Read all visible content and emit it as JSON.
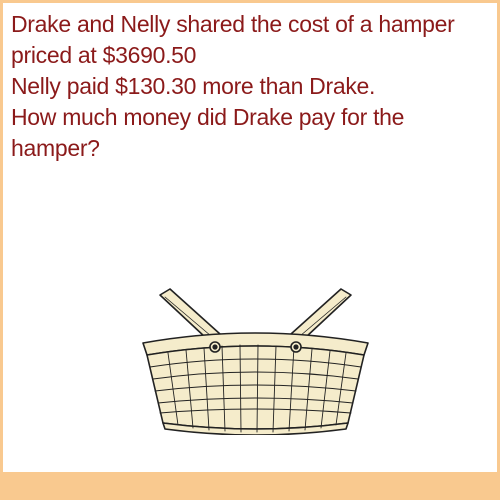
{
  "question": {
    "lines": [
      "Drake and Nelly shared the cost of a hamper",
      "priced at $3690.50",
      "Nelly paid $130.30 more than Drake.",
      "How much money did Drake pay for the",
      "hamper?"
    ]
  },
  "colors": {
    "text": "#8b1a1a",
    "border": "#f9c98f",
    "basket_fill": "#f5eccb",
    "basket_line": "#222222"
  },
  "illustration": {
    "icon": "basket-icon"
  }
}
